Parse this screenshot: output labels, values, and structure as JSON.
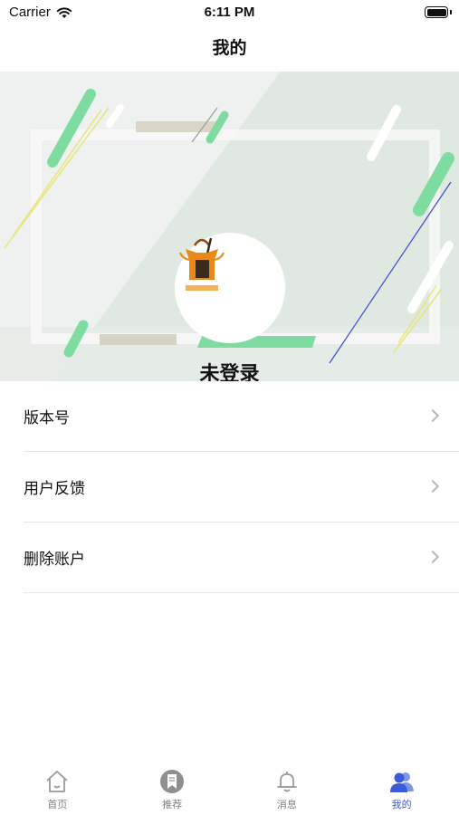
{
  "status_bar": {
    "carrier": "Carrier",
    "time": "6:11 PM"
  },
  "nav": {
    "title": "我的"
  },
  "profile": {
    "login_status": "未登录"
  },
  "menu": {
    "items": [
      {
        "label": "版本号"
      },
      {
        "label": "用户反馈"
      },
      {
        "label": "删除账户"
      }
    ]
  },
  "tabs": [
    {
      "label": "首页",
      "icon": "home-icon"
    },
    {
      "label": "推荐",
      "icon": "bookmark-icon"
    },
    {
      "label": "消息",
      "icon": "bell-icon"
    },
    {
      "label": "我的",
      "icon": "users-icon",
      "active": true
    }
  ],
  "colors": {
    "accent": "#3b5bd9",
    "banner_green": "#7fdca0",
    "banner_bg": "#dfe9e2"
  }
}
